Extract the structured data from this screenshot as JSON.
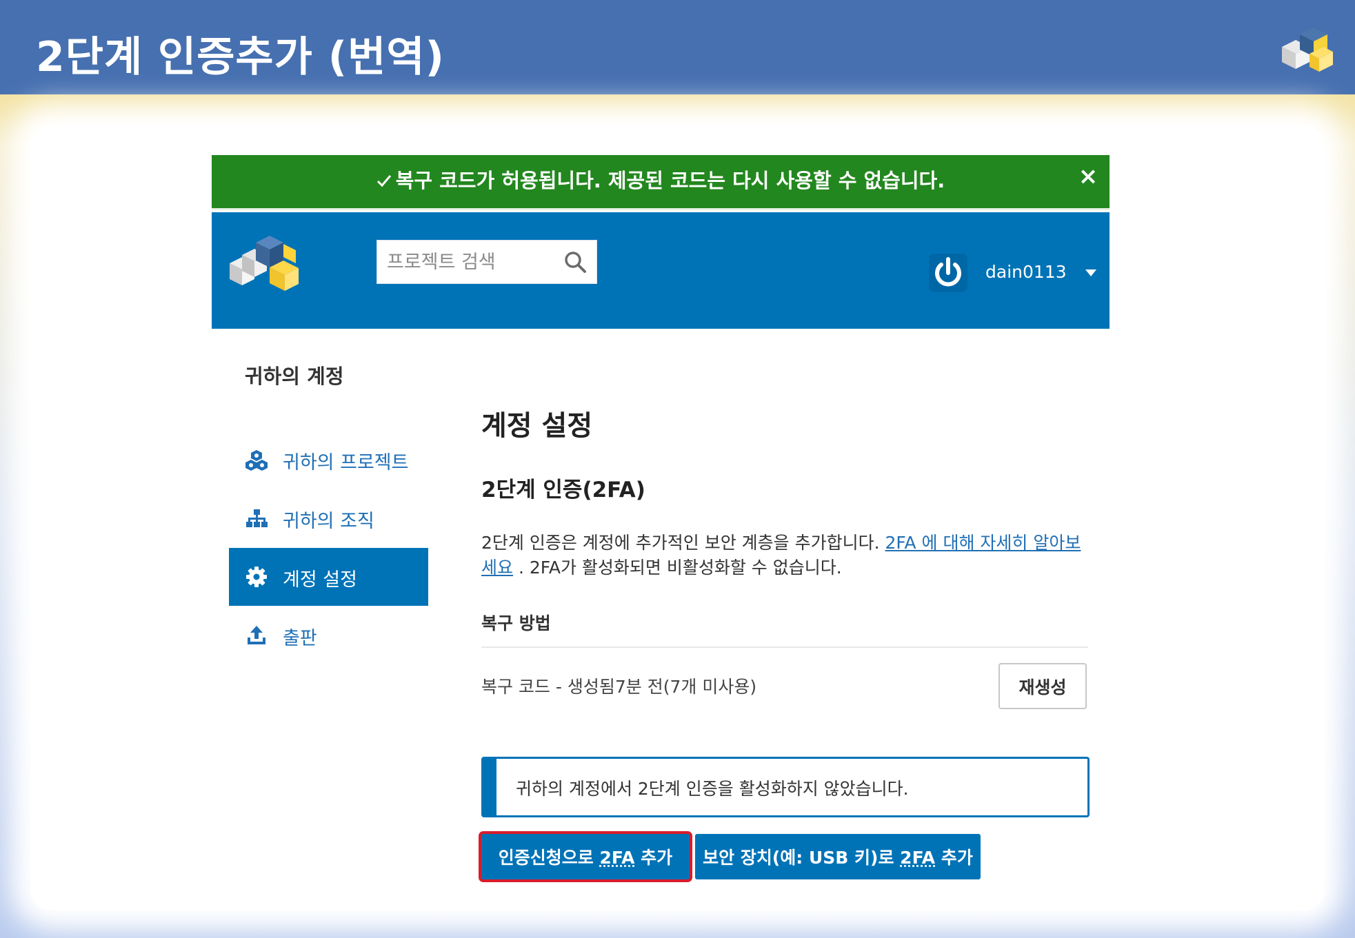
{
  "slide": {
    "title": "2단계 인증추가 (번역)",
    "colors": {
      "header": "#4670b0",
      "accent_yellow": "#f3e3a3"
    }
  },
  "flash": {
    "message": "복구 코드가 허용됩니다. 제공된 코드는 다시 사용할 수 없습니다.",
    "check_icon": "check-icon",
    "close_icon": "close-icon",
    "close_glyph": "×",
    "color": "#23871f"
  },
  "header": {
    "search_placeholder": "프로젝트 검색",
    "username": "dain0113",
    "color": "#0073b7"
  },
  "sidebar": {
    "title": "귀하의 계정",
    "items": [
      {
        "label": "귀하의 프로젝트",
        "icon": "cubes-icon",
        "active": false
      },
      {
        "label": "귀하의 조직",
        "icon": "sitemap-icon",
        "active": false
      },
      {
        "label": "계정 설정",
        "icon": "gear-icon",
        "active": true
      },
      {
        "label": "출판",
        "icon": "upload-icon",
        "active": false
      }
    ]
  },
  "main": {
    "page_title": "계정 설정",
    "section_title": "2단계 인증(2FA)",
    "description": "2단계 인증은 계정에 추가적인 보안 계층을 추가합니다.",
    "learn_more_link": "2FA 에 대해 자세히 알아보세요",
    "description_tail": ". 2FA가 활성화되면 비활성화할 수 없습니다.",
    "recovery_heading": "복구 방법",
    "recovery_row": "복구 코드 - 생성됨7분 전(7개 미사용)",
    "regenerate_label": "재생성",
    "callout": "귀하의 계정에서 2단계 인증을 활성화하지 않았습니다.",
    "btn_webauthn_prefix": "인증신청으로 ",
    "btn_webauthn_abbr": "2FA",
    "btn_webauthn_suffix": " 추가",
    "btn_usb_prefix": "보안 장치(예: USB 키)로 ",
    "btn_usb_abbr": "2FA",
    "btn_usb_suffix": " 추가"
  }
}
